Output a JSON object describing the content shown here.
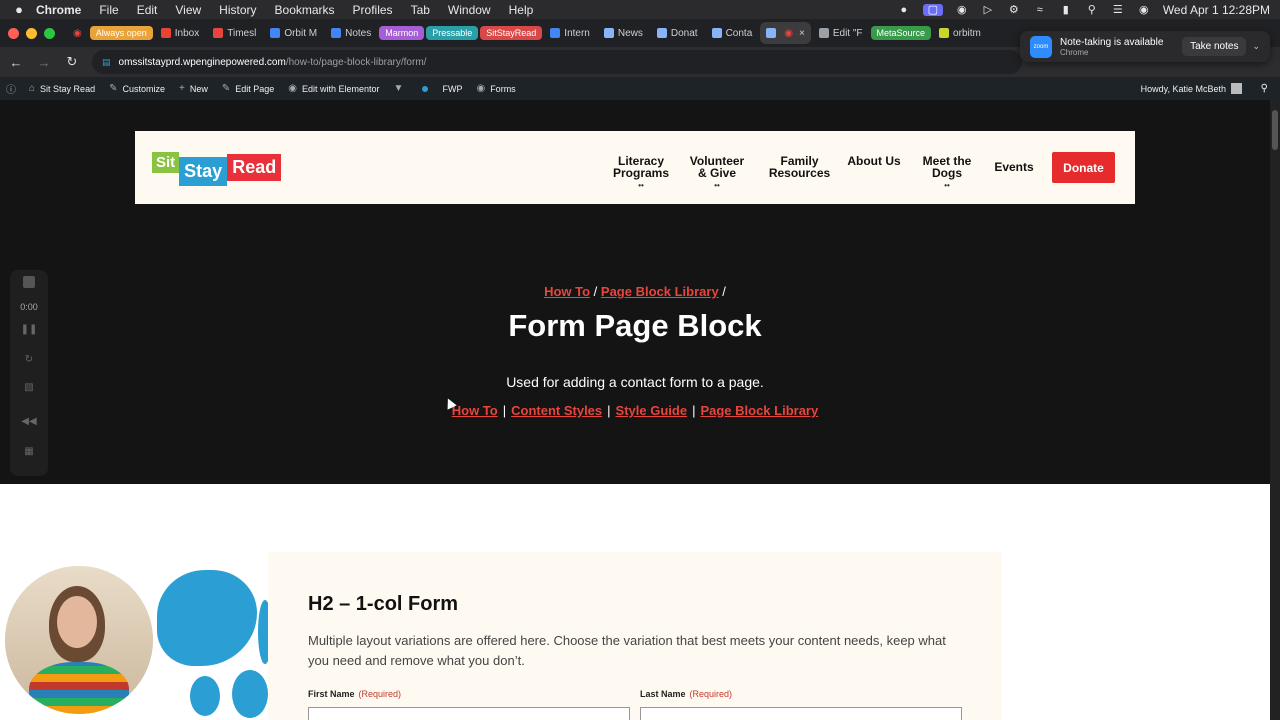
{
  "menubar": {
    "app": "Chrome",
    "items": [
      "File",
      "Edit",
      "View",
      "History",
      "Bookmarks",
      "Profiles",
      "Tab",
      "Window",
      "Help"
    ],
    "datetime": "Wed Apr 1  12:28PM"
  },
  "tabs": [
    {
      "label": "Always open",
      "pill": true,
      "color": "#e8a33a"
    },
    {
      "label": "Inbox",
      "fav": "#ea4335"
    },
    {
      "label": "Timesl",
      "fav": "#e8453c"
    },
    {
      "label": "Orbit M",
      "fav": "#4285f4"
    },
    {
      "label": "Notes",
      "fav": "#4285f4"
    },
    {
      "label": "Marmon",
      "pill": true,
      "color": "#a55fd6"
    },
    {
      "label": "Pressable",
      "pill": true,
      "color": "#2b9fa8"
    },
    {
      "label": "SitStayRead",
      "pill": true,
      "color": "#d94848"
    },
    {
      "label": "Intern",
      "fav": "#4285f4"
    },
    {
      "label": "News",
      "fav": "#8ab4f8"
    },
    {
      "label": "Donat",
      "fav": "#8ab4f8"
    },
    {
      "label": "Conta",
      "fav": "#8ab4f8"
    },
    {
      "label": "",
      "fav": "#8ab4f8",
      "active": true
    },
    {
      "label": "Edit \"F",
      "fav": "#9aa0a6"
    },
    {
      "label": "MetaSource",
      "pill": true,
      "color": "#3a9a4c"
    },
    {
      "label": "orbitm",
      "fav": "#c9d92b"
    }
  ],
  "address": {
    "domain": "omssitstayprd.wpenginepowered.com",
    "path": "/how-to/page-block-library/form/"
  },
  "toast": {
    "title": "Note-taking is available",
    "subtitle": "Chrome",
    "button": "Take notes",
    "logo": "zoom"
  },
  "wpbar": {
    "items": [
      "Sit Stay Read",
      "Customize",
      "New",
      "Edit Page",
      "Edit with Elementor",
      "FWP",
      "Forms"
    ],
    "howdy": "Howdy, Katie McBeth"
  },
  "site": {
    "logo": [
      "Sit",
      "Stay",
      "Read"
    ],
    "nav": [
      {
        "label": "Literacy Programs",
        "paw": true
      },
      {
        "label": "Volunteer & Give",
        "paw": true
      },
      {
        "label": "Family Resources",
        "paw": false
      },
      {
        "label": "About Us",
        "paw": false
      },
      {
        "label": "Meet the Dogs",
        "paw": true
      },
      {
        "label": "Events",
        "paw": false
      }
    ],
    "donate": "Donate"
  },
  "hero": {
    "breadcrumb": [
      "How To",
      "Page Block Library"
    ],
    "title": "Form Page Block",
    "description": "Used for adding a contact form to a page.",
    "links": [
      "How To",
      "Content Styles",
      "Style Guide",
      "Page Block Library"
    ]
  },
  "form": {
    "heading": "H2 – 1-col Form",
    "description": "Multiple layout variations are offered here. Choose the variation that best meets your content needs, keep what you need and remove what you don’t.",
    "first_name_label": "First Name",
    "last_name_label": "Last Name",
    "required": "(Required)"
  },
  "recorder": {
    "time": "0:00"
  },
  "colors": {
    "accent": "#e8453c",
    "brand_blue": "#2b9fd3",
    "donate": "#e52b2b"
  }
}
